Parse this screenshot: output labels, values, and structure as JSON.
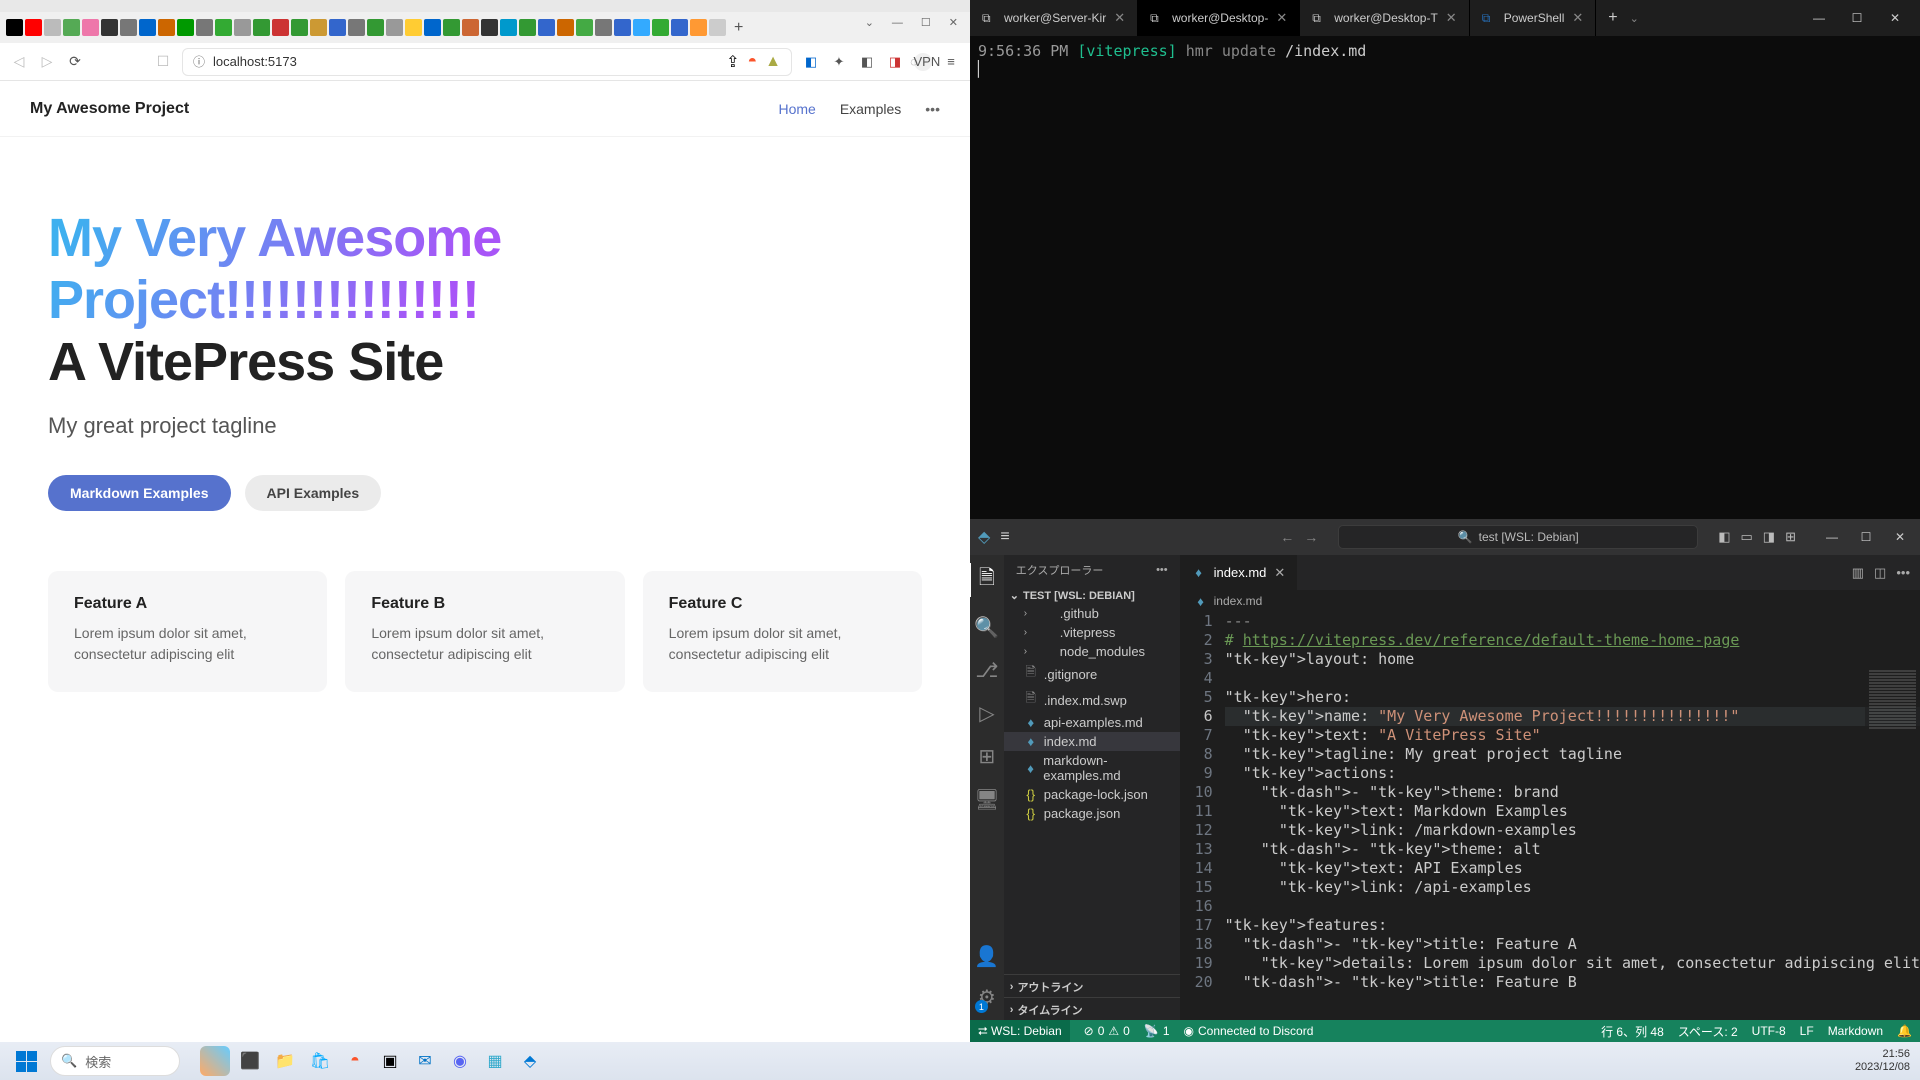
{
  "browser": {
    "url": "localhost:5173",
    "vpn": "VPN",
    "nav": {
      "brand": "My Awesome Project",
      "links": [
        "Home",
        "Examples"
      ]
    },
    "hero": {
      "name": "My Very Awesome Project!!!!!!!!!!!!!!!",
      "text": "A VitePress Site",
      "tagline": "My great project tagline",
      "actions": [
        {
          "label": "Markdown Examples",
          "theme": "brand"
        },
        {
          "label": "API Examples",
          "theme": "alt"
        }
      ]
    },
    "features": [
      {
        "title": "Feature A",
        "details": "Lorem ipsum dolor sit amet, consectetur adipiscing elit"
      },
      {
        "title": "Feature B",
        "details": "Lorem ipsum dolor sit amet, consectetur adipiscing elit"
      },
      {
        "title": "Feature C",
        "details": "Lorem ipsum dolor sit amet, consectetur adipiscing elit"
      }
    ]
  },
  "terminal": {
    "tabs": [
      "worker@Server-Kir",
      "worker@Desktop-",
      "worker@Desktop-T",
      "PowerShell"
    ],
    "active_tab": 1,
    "line": {
      "time": "9:56:36 PM",
      "tag": "[vitepress]",
      "msg": "hmr update",
      "file": "/index.md"
    }
  },
  "vscode": {
    "command_center": "test [WSL: Debian]",
    "explorer_label": "エクスプローラー",
    "workspace": "TEST [WSL: DEBIAN]",
    "tree": [
      {
        "name": ".github",
        "type": "folder"
      },
      {
        "name": ".vitepress",
        "type": "folder"
      },
      {
        "name": "node_modules",
        "type": "folder"
      },
      {
        "name": ".gitignore",
        "type": "txt"
      },
      {
        "name": ".index.md.swp",
        "type": "txt"
      },
      {
        "name": "api-examples.md",
        "type": "md"
      },
      {
        "name": "index.md",
        "type": "md",
        "selected": true
      },
      {
        "name": "markdown-examples.md",
        "type": "md"
      },
      {
        "name": "package-lock.json",
        "type": "json"
      },
      {
        "name": "package.json",
        "type": "json"
      }
    ],
    "outline": "アウトライン",
    "timeline": "タイムライン",
    "open_file": "index.md",
    "breadcrumb": "index.md",
    "code": [
      {
        "n": 1,
        "raw": "---"
      },
      {
        "n": 2,
        "raw": "# https://vitepress.dev/reference/default-theme-home-page"
      },
      {
        "n": 3,
        "raw": "layout: home"
      },
      {
        "n": 4,
        "raw": ""
      },
      {
        "n": 5,
        "raw": "hero:"
      },
      {
        "n": 6,
        "raw": "  name: \"My Very Awesome Project!!!!!!!!!!!!!!!\"",
        "hl": true
      },
      {
        "n": 7,
        "raw": "  text: \"A VitePress Site\""
      },
      {
        "n": 8,
        "raw": "  tagline: My great project tagline"
      },
      {
        "n": 9,
        "raw": "  actions:"
      },
      {
        "n": 10,
        "raw": "    - theme: brand"
      },
      {
        "n": 11,
        "raw": "      text: Markdown Examples"
      },
      {
        "n": 12,
        "raw": "      link: /markdown-examples"
      },
      {
        "n": 13,
        "raw": "    - theme: alt"
      },
      {
        "n": 14,
        "raw": "      text: API Examples"
      },
      {
        "n": 15,
        "raw": "      link: /api-examples"
      },
      {
        "n": 16,
        "raw": ""
      },
      {
        "n": 17,
        "raw": "features:"
      },
      {
        "n": 18,
        "raw": "  - title: Feature A"
      },
      {
        "n": 19,
        "raw": "    details: Lorem ipsum dolor sit amet, consectetur adipiscing elit"
      },
      {
        "n": 20,
        "raw": "  - title: Feature B"
      }
    ],
    "current_line": 6,
    "status": {
      "remote": "WSL: Debian",
      "errors": "0",
      "warnings": "0",
      "ports": "1",
      "discord": "Connected to Discord",
      "pos": "行 6、列 48",
      "spaces": "スペース: 2",
      "encoding": "UTF-8",
      "eol": "LF",
      "lang": "Markdown"
    }
  },
  "taskbar": {
    "search": "検索",
    "time": "21:56",
    "date": "2023/12/08"
  }
}
